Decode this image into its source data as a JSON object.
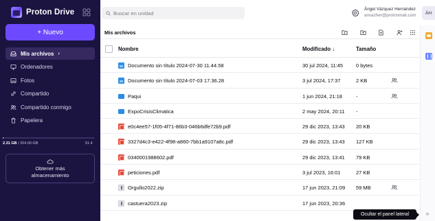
{
  "app": {
    "name": "Proton Drive"
  },
  "sidebar": {
    "new_button": "+ Nuevo",
    "items": [
      {
        "label": "Mis archivos",
        "icon": "inbox-icon",
        "active": true
      },
      {
        "label": "Ordenadores",
        "icon": "monitor-icon"
      },
      {
        "label": "Fotos",
        "icon": "image-icon"
      },
      {
        "label": "Compartido",
        "icon": "link-icon"
      },
      {
        "label": "Compartido conmigo",
        "icon": "users-icon"
      },
      {
        "label": "Papelera",
        "icon": "trash-icon"
      }
    ],
    "storage": {
      "used": "2.31 GB",
      "separator": " / ",
      "total": "204.00 GB",
      "percent": "51.4",
      "fill_fraction": 0.011
    },
    "get_more": {
      "line1": "Obtener más",
      "line2": "almacenamiento"
    }
  },
  "search": {
    "placeholder": "Buscar en unidad"
  },
  "user": {
    "name": "Ángel Vázquez Hernández",
    "email": "anvazher@protonmail.com",
    "initials": "ÁH"
  },
  "toolbar": {
    "title": "Mis archivos"
  },
  "table": {
    "headers": {
      "name": "Nombre",
      "modified": "Modificado ↓",
      "size": "Tamaño"
    },
    "rows": [
      {
        "type": "doc",
        "name": "Documento sin título 2024-07-30 11.44.58",
        "modified": "30 jul 2024, 11:45",
        "size": "0 bytes",
        "shared": false
      },
      {
        "type": "doc",
        "name": "Documento sin título 2024-07-03 17.36.28",
        "modified": "3 jul 2024, 17:37",
        "size": "2 KB",
        "shared": true
      },
      {
        "type": "folder",
        "name": "Paqui",
        "modified": "1 jun 2024, 21:18",
        "size": "-",
        "shared": true
      },
      {
        "type": "folder",
        "name": "ExpoCrisisClimatica",
        "modified": "2 may 2024, 20:11",
        "size": "-",
        "shared": false
      },
      {
        "type": "pdf",
        "name": "e0c4ee57-1f05-4f71-86b3-046b6dfe72b9.pdf",
        "modified": "29 dic 2023, 13:43",
        "size": "20 KB",
        "shared": false
      },
      {
        "type": "pdf",
        "name": "3327d4c3-e422-4f98-a860-7bb1a9107a8c.pdf",
        "modified": "29 dic 2023, 13:43",
        "size": "127 KB",
        "shared": false
      },
      {
        "type": "pdf",
        "name": "0340001988602.pdf",
        "modified": "29 dic 2023, 13:41",
        "size": "79 KB",
        "shared": false
      },
      {
        "type": "pdf",
        "name": "peticiones.pdf",
        "modified": "3 jul 2023, 16:01",
        "size": "27 KB",
        "shared": false
      },
      {
        "type": "zip",
        "name": "Orgullo2022.zip",
        "modified": "17 jun 2023, 21:09",
        "size": "59 MB",
        "shared": true
      },
      {
        "type": "zip",
        "name": "castuera2023.zip",
        "modified": "17 jun 2023, 20:36",
        "size": "",
        "shared": false
      }
    ]
  },
  "rail": {
    "tooltip": "Ocultar el panel lateral",
    "toggle": "»"
  }
}
